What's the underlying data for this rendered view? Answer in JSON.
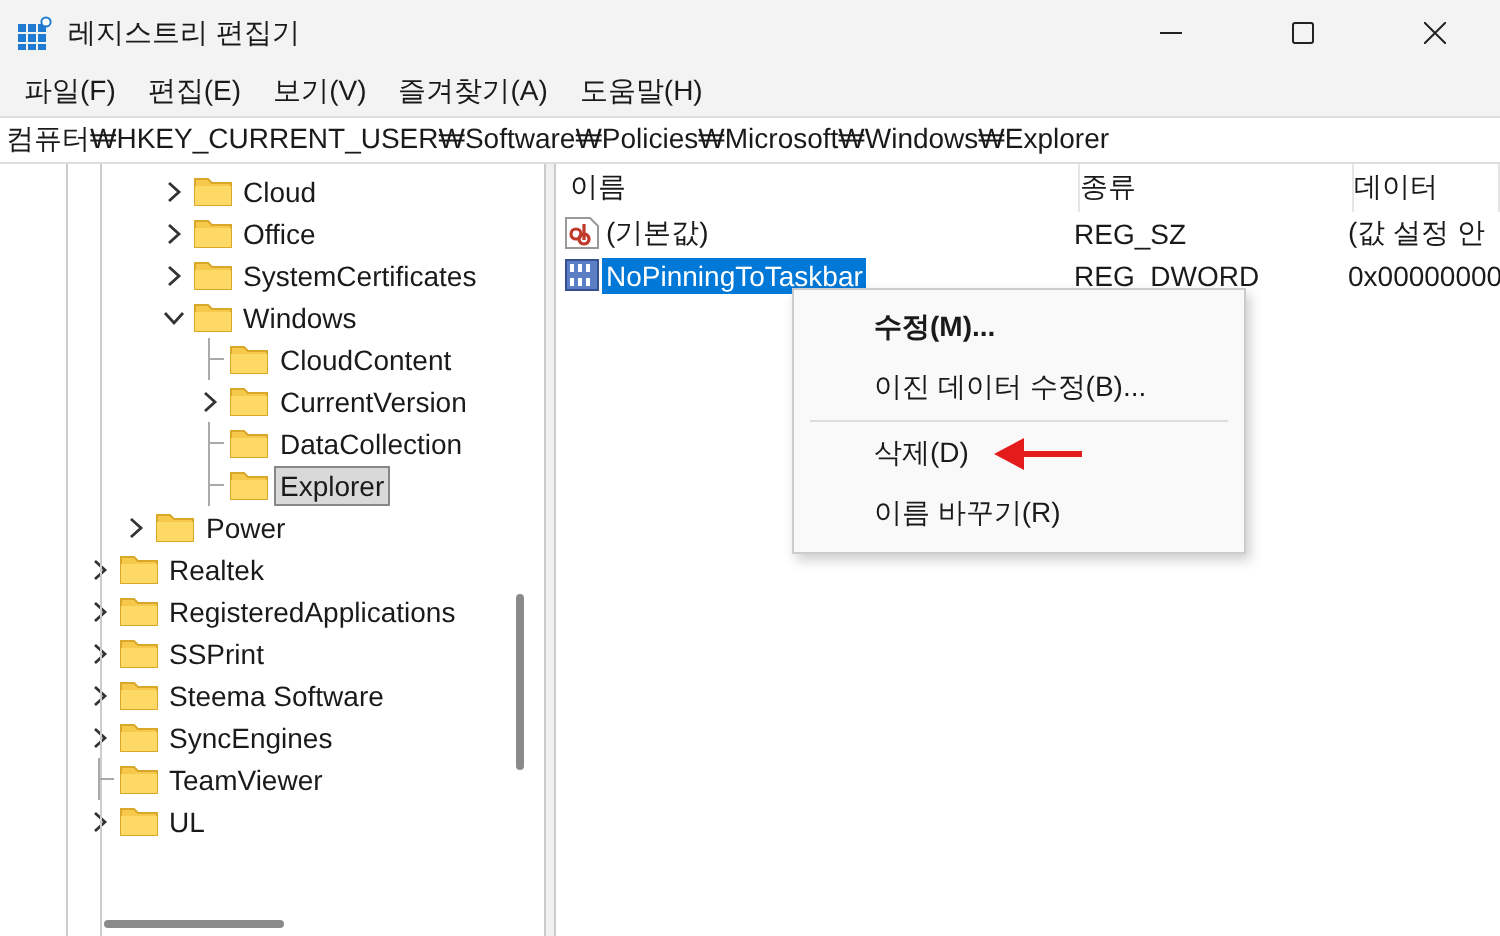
{
  "window": {
    "title": "레지스트리 편집기"
  },
  "menu": [
    {
      "label": "파일(F)"
    },
    {
      "label": "편집(E)"
    },
    {
      "label": "보기(V)"
    },
    {
      "label": "즐겨찾기(A)"
    },
    {
      "label": "도움말(H)"
    }
  ],
  "address": "컴퓨터₩HKEY_CURRENT_USER₩Software₩Policies₩Microsoft₩Windows₩Explorer",
  "tree": [
    {
      "children": [
        {
          "children": [
            {
              "label": "Cloud",
              "expanded": false,
              "expandable": true,
              "selected": false
            },
            {
              "label": "Office",
              "expanded": false,
              "expandable": true,
              "selected": false
            },
            {
              "label": "SystemCertificates",
              "expanded": false,
              "expandable": true,
              "selected": false
            },
            {
              "label": "Windows",
              "expanded": true,
              "expandable": true,
              "selected": false,
              "children": [
                {
                  "label": "CloudContent",
                  "expandable": false,
                  "selected": false
                },
                {
                  "label": "CurrentVersion",
                  "expanded": false,
                  "expandable": true,
                  "selected": false
                },
                {
                  "label": "DataCollection",
                  "expandable": false,
                  "selected": false
                },
                {
                  "label": "Explorer",
                  "expandable": false,
                  "selected": true
                }
              ]
            }
          ]
        },
        {
          "label": "Power",
          "expanded": false,
          "expandable": true,
          "selected": false
        }
      ]
    },
    {
      "label": "Realtek",
      "expanded": false,
      "expandable": true,
      "selected": false
    },
    {
      "label": "RegisteredApplications",
      "expanded": false,
      "expandable": true,
      "selected": false
    },
    {
      "label": "SSPrint",
      "expanded": false,
      "expandable": true,
      "selected": false
    },
    {
      "label": "Steema Software",
      "expanded": false,
      "expandable": true,
      "selected": false
    },
    {
      "label": "SyncEngines",
      "expanded": false,
      "expandable": true,
      "selected": false
    },
    {
      "label": "TeamViewer",
      "expandable": false,
      "selected": false
    },
    {
      "label": "UL",
      "expanded": false,
      "expandable": true,
      "selected": false
    }
  ],
  "table": {
    "columns": [
      "이름",
      "종류",
      "데이터"
    ],
    "rows": [
      {
        "kind": "string",
        "name": "(기본값)",
        "type": "REG_SZ",
        "data": "(값 설정 안",
        "selected": false
      },
      {
        "kind": "binary",
        "name": "NoPinningToTaskbar",
        "type": "REG_DWORD",
        "data": "0x00000000",
        "selected": true
      }
    ]
  },
  "context_menu": {
    "items": [
      {
        "kind": "item",
        "label": "수정(M)...",
        "bold": true
      },
      {
        "kind": "item",
        "label": "이진 데이터 수정(B)...",
        "bold": false
      },
      {
        "kind": "separator"
      },
      {
        "kind": "item",
        "label": "삭제(D)",
        "bold": false,
        "pointed": true
      },
      {
        "kind": "item",
        "label": "이름 바꾸기(R)",
        "bold": false
      }
    ]
  }
}
